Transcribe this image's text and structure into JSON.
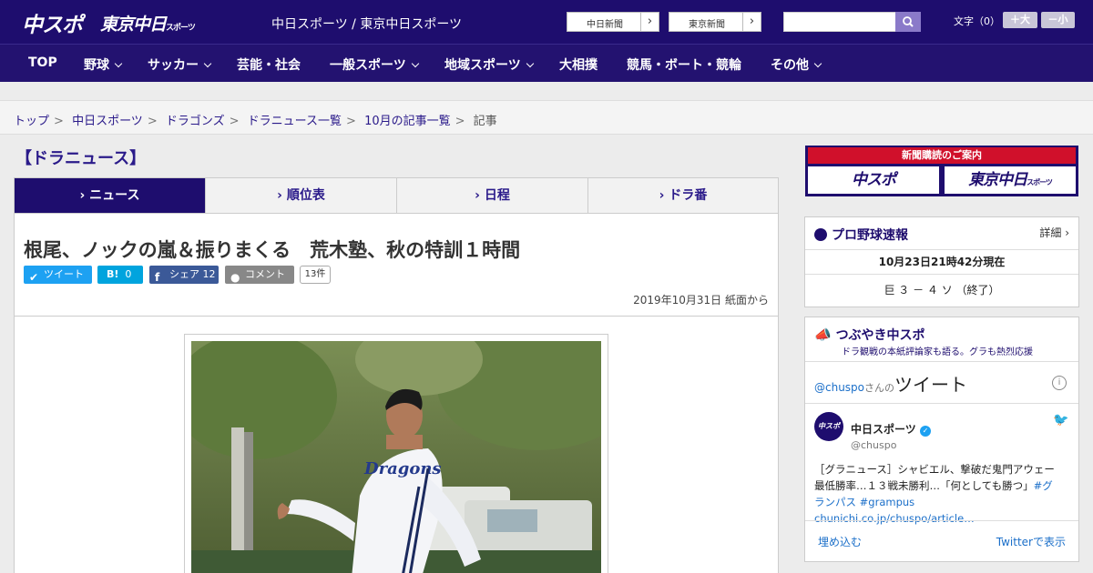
{
  "header": {
    "logo_main": "中スポ",
    "logo_sub": "東京中日",
    "logo_sub_small": "スポーツ",
    "site_name": "中日スポーツ / 東京中日スポーツ",
    "paper_links": [
      "中日新聞",
      "東京新聞"
    ],
    "search_placeholder": "",
    "font_size_label": "文字（0）",
    "font_larger": "＋大",
    "font_smaller": "－小"
  },
  "nav": [
    "TOP",
    "野球",
    "サッカー",
    "芸能・社会",
    "一般スポーツ",
    "地域スポーツ",
    "大相撲",
    "競馬・ボート・競輪",
    "その他"
  ],
  "breadcrumb": [
    "トップ",
    "中日スポーツ",
    "ドラゴンズ",
    "ドラニュース一覧",
    "10月の記事一覧",
    "記事"
  ],
  "section_title": "【ドラニュース】",
  "tabs": [
    "ニュース",
    "順位表",
    "日程",
    "ドラ番"
  ],
  "article": {
    "headline": "根尾、ノックの嵐＆振りまくる　荒木塾、秋の特訓１時間",
    "share": {
      "tweet": "ツイート",
      "hatena": "B!",
      "hatena_count": "0",
      "facebook": "シェア",
      "facebook_count": "12",
      "comment": "コメント",
      "comment_count": "13件"
    },
    "date": "2019年10月31日 紙面から"
  },
  "photo": {
    "jersey_text": "Dragons"
  },
  "sidebar": {
    "ad_title": "新聞購読のご案内",
    "ad_left": "中スポ",
    "ad_right": "東京中日",
    "ad_right_small": "スポーツ",
    "baseball": {
      "title": "プロ野球速報",
      "detail": "詳細 ›",
      "time": "10月23日21時42分現在",
      "score": "巨 ３ － ４ ソ （終了）"
    },
    "tsubuyaki": {
      "title": "つぶやき中スポ",
      "subtitle": "ドラ観戦の本紙評論家も語る。グラも熱烈応援",
      "tweets_of_prefix": "@chuspo",
      "tweets_of_mid": "さんの",
      "tweets_of_suffix": "ツイート",
      "account_name": "中日スポーツ",
      "handle": "@chuspo",
      "avatar_text": "中スポ",
      "tweet_text": "［グラニュース］シャビエル、撃破だ鬼門アウェー　最低勝率…１３戦未勝利…「何としても勝つ」",
      "tweet_tags": "#グランパス #grampus",
      "tweet_link": "chunichi.co.jp/chuspo/article…",
      "embed": "埋め込む",
      "view_on_twitter": "Twitterで表示"
    }
  }
}
